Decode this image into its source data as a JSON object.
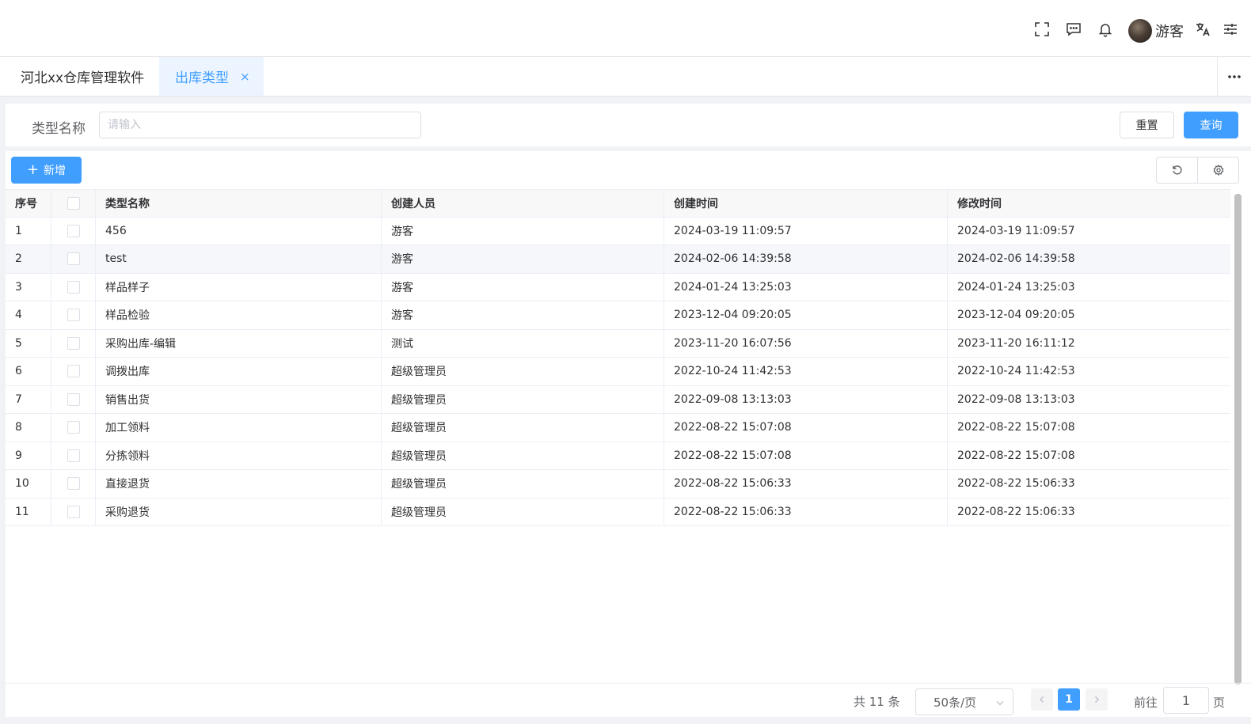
{
  "header": {
    "user_name": "游客",
    "icons": [
      "fullscreen-icon",
      "message-icon",
      "bell-icon",
      "translate-icon",
      "settings-sliders-icon"
    ]
  },
  "tabs": [
    {
      "label": "河北xx仓库管理软件",
      "active": false
    },
    {
      "label": "出库类型",
      "active": true,
      "close": "×"
    }
  ],
  "search": {
    "label": "类型名称",
    "placeholder": "请输入",
    "reset_label": "重置",
    "query_label": "查询"
  },
  "toolbar": {
    "add_label": "新增"
  },
  "table": {
    "columns": [
      "序号",
      "",
      "类型名称",
      "创建人员",
      "创建时间",
      "修改时间"
    ],
    "rows": [
      {
        "index": "1",
        "name": "456",
        "creator": "游客",
        "created": "2024-03-19 11:09:57",
        "modified": "2024-03-19 11:09:57"
      },
      {
        "index": "2",
        "name": "test",
        "creator": "游客",
        "created": "2024-02-06 14:39:58",
        "modified": "2024-02-06 14:39:58"
      },
      {
        "index": "3",
        "name": "样品样子",
        "creator": "游客",
        "created": "2024-01-24 13:25:03",
        "modified": "2024-01-24 13:25:03"
      },
      {
        "index": "4",
        "name": "样品检验",
        "creator": "游客",
        "created": "2023-12-04 09:20:05",
        "modified": "2023-12-04 09:20:05"
      },
      {
        "index": "5",
        "name": "采购出库-编辑",
        "creator": "测试",
        "created": "2023-11-20 16:07:56",
        "modified": "2023-11-20 16:11:12"
      },
      {
        "index": "6",
        "name": "调拨出库",
        "creator": "超级管理员",
        "created": "2022-10-24 11:42:53",
        "modified": "2022-10-24 11:42:53"
      },
      {
        "index": "7",
        "name": "销售出货",
        "creator": "超级管理员",
        "created": "2022-09-08 13:13:03",
        "modified": "2022-09-08 13:13:03"
      },
      {
        "index": "8",
        "name": "加工领料",
        "creator": "超级管理员",
        "created": "2022-08-22 15:07:08",
        "modified": "2022-08-22 15:07:08"
      },
      {
        "index": "9",
        "name": "分拣领料",
        "creator": "超级管理员",
        "created": "2022-08-22 15:07:08",
        "modified": "2022-08-22 15:07:08"
      },
      {
        "index": "10",
        "name": "直接退货",
        "creator": "超级管理员",
        "created": "2022-08-22 15:06:33",
        "modified": "2022-08-22 15:06:33"
      },
      {
        "index": "11",
        "name": "采购退货",
        "creator": "超级管理员",
        "created": "2022-08-22 15:06:33",
        "modified": "2022-08-22 15:06:33"
      }
    ]
  },
  "pagination": {
    "total_text": "共 11 条",
    "page_size": "50条/页",
    "current_page": "1",
    "goto_label": "前往",
    "goto_value": "1",
    "page_suffix": "页"
  },
  "colors": {
    "primary": "#409eff",
    "active_tab_bg": "#ecf5ff",
    "border": "#dcdfe6"
  }
}
